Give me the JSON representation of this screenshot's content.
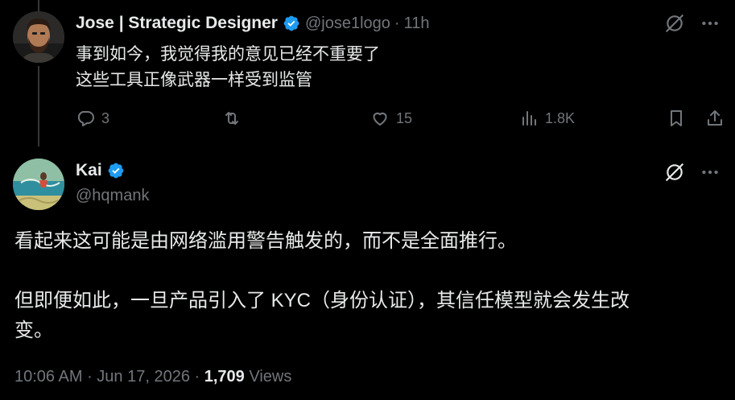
{
  "parent_tweet": {
    "display_name": "Jose | Strategic Designer",
    "handle": "@jose1logo",
    "separator": "·",
    "time": "11h",
    "lines": [
      "事到如今，我觉得我的意见已经不重要了",
      "这些工具正像武器一样受到监管"
    ],
    "actions": {
      "replies": "3",
      "reposts": "",
      "likes": "15",
      "views": "1.8K"
    }
  },
  "main_tweet": {
    "display_name": "Kai",
    "handle": "@hqmank",
    "paragraphs": [
      [
        "看起来这可能是由网络滥用警告触发的，而不是全面推行。"
      ],
      [
        "但即便如此，一旦产品引入了 KYC（身份认证），其信任模型就会发生改",
        "变。"
      ]
    ],
    "timestamp": "10:06 AM",
    "separator1": " · ",
    "date": "Jun 17, 2026",
    "separator2": " · ",
    "views_count": "1,709",
    "views_label": " Views"
  },
  "colors": {
    "background": "#000000",
    "text_primary": "#e7e9ea",
    "text_secondary": "#71767b",
    "verified_blue": "#1d9bf0",
    "divider": "#333639"
  }
}
